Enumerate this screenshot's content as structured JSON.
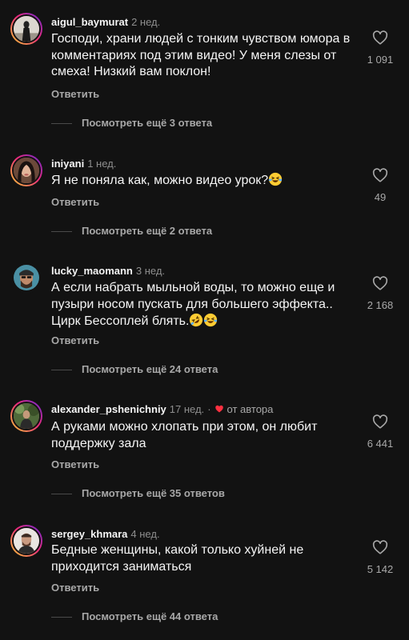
{
  "comments": [
    {
      "username": "aigul_baymurat",
      "time": "2 нед.",
      "text": "Господи, храни людей с тонким чувством юмора в комментариях под этим видео! У меня слезы от смеха! Низкий вам поклон!",
      "likes": "1 091",
      "reply_label": "Ответить",
      "view_replies": "Посмотреть ещё 3 ответа",
      "avatar_ring": true,
      "avatar": "avatar-photo"
    },
    {
      "username": "iniyani",
      "time": "1 нед.",
      "text": "Я не поняла как, можно видео урок?",
      "emoji": [
        "laughing-tears-emoji"
      ],
      "likes": "49",
      "reply_label": "Ответить",
      "view_replies": "Посмотреть ещё 2 ответа",
      "avatar_ring": true,
      "avatar": "avatar-photo"
    },
    {
      "username": "lucky_maomann",
      "time": "3 нед.",
      "text": "А если набрать мыльной воды, то можно еще и пузыри носом пускать для большего эффекта.. Цирк Бессоплей блять.",
      "emoji": [
        "rofl-emoji",
        "laughing-tears-emoji"
      ],
      "likes": "2 168",
      "reply_label": "Ответить",
      "view_replies": "Посмотреть ещё 24 ответа",
      "avatar_ring": false,
      "avatar": "avatar-photo"
    },
    {
      "username": "alexander_pshenichniy",
      "time": "17 нед.",
      "separator": "·",
      "author_badge": "от автора",
      "text": "А руками можно хлопать при этом, он любит поддержку зала",
      "likes": "6 441",
      "reply_label": "Ответить",
      "view_replies": "Посмотреть ещё 35 ответов",
      "avatar_ring": true,
      "avatar": "avatar-photo"
    },
    {
      "username": "sergey_khmara",
      "time": "4 нед.",
      "text": "Бедные женщины, какой только хуйней не приходится заниматься",
      "likes": "5 142",
      "reply_label": "Ответить",
      "view_replies": "Посмотреть ещё 44 ответа",
      "avatar_ring": true,
      "avatar": "avatar-photo"
    }
  ],
  "colors": {
    "background": "#121212",
    "primary_text": "#f5f5f5",
    "secondary_text": "#a8a8a8",
    "author_heart": "#ff3040",
    "story_ring": [
      "#f9ce34",
      "#ee2a7b",
      "#6228d7"
    ]
  },
  "icons": {
    "like": "heart-outline-icon",
    "author_like": "heart-filled-icon"
  }
}
